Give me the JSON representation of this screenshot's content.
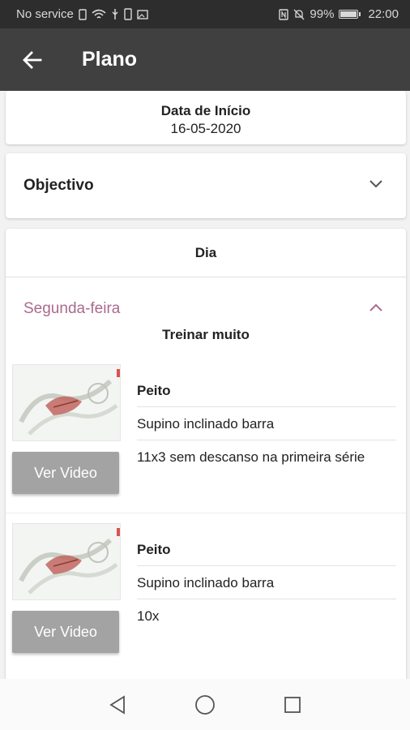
{
  "status_bar": {
    "carrier": "No service",
    "battery": "99%",
    "time": "22:00"
  },
  "app_bar": {
    "title": "Plano"
  },
  "start_date": {
    "label": "Data de Início",
    "value": "16-05-2020"
  },
  "objective": {
    "label": "Objectivo"
  },
  "day_section": {
    "header": "Dia",
    "day_label": "Segunda-feira",
    "note": "Treinar muito",
    "exercises": [
      {
        "muscle": "Peito",
        "name": "Supino inclinado barra",
        "detail": "11x3 sem descanso na primeira série",
        "video_button": "Ver Video"
      },
      {
        "muscle": "Peito",
        "name": "Supino inclinado barra",
        "detail": "10x",
        "video_button": "Ver Video"
      }
    ]
  },
  "colors": {
    "status_bar": "#2d2d2d",
    "app_bar": "#404040",
    "day_accent": "#a96a8e",
    "button": "#a3a3a3"
  }
}
